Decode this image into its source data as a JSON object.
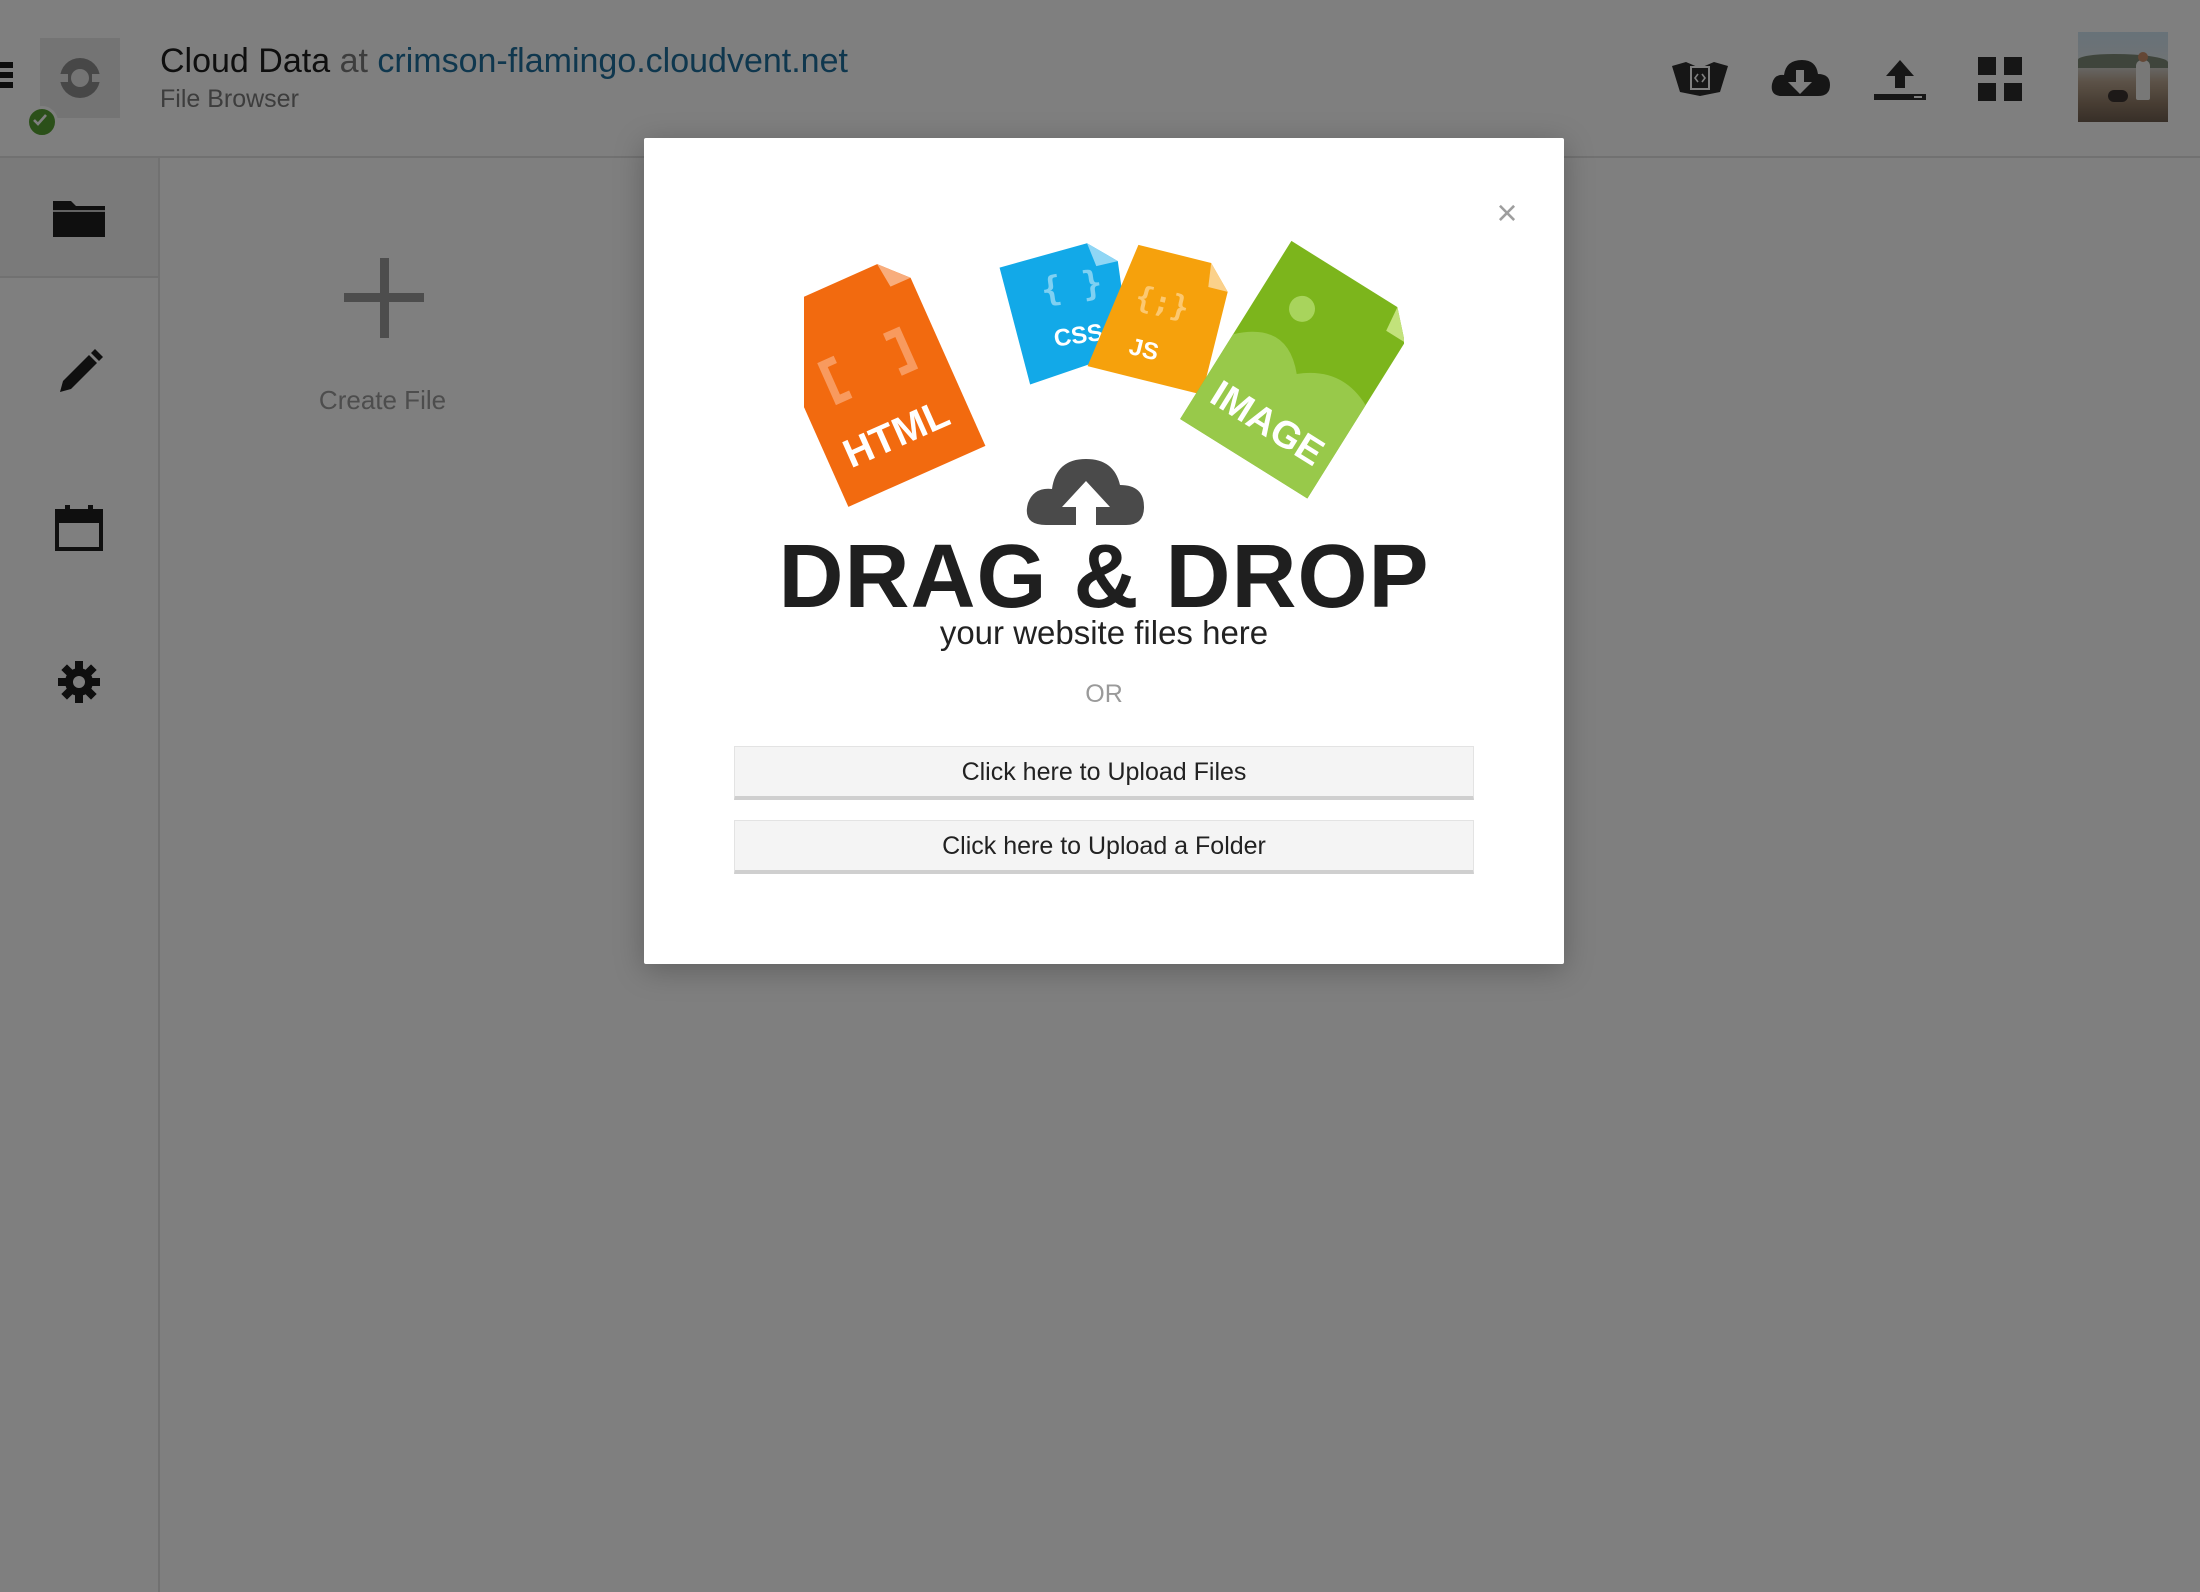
{
  "header": {
    "app_name": "Cloud Data",
    "at_word": "at",
    "domain": "crimson-flamingo.cloudvent.net",
    "subtitle": "File Browser",
    "icons": [
      "menu-icon",
      "app-logo-icon",
      "status-check-icon",
      "code-preview-icon",
      "cloud-download-icon",
      "upload-icon",
      "grid-icon",
      "avatar"
    ]
  },
  "sidebar": {
    "items": [
      {
        "icon": "folder-icon",
        "active": true
      },
      {
        "icon": "pencil-icon",
        "active": false
      },
      {
        "icon": "calendar-icon",
        "active": false
      },
      {
        "icon": "gear-icon",
        "active": false
      }
    ]
  },
  "main": {
    "create_file_label": "Create File"
  },
  "modal": {
    "close_symbol": "×",
    "illustration": {
      "html_label": "HTML",
      "css_label": "CSS",
      "js_label": "JS",
      "image_label": "IMAGE"
    },
    "headline": "DRAG & DROP",
    "subline": "your website files here",
    "or_text": "OR",
    "upload_files_label": "Click here to Upload Files",
    "upload_folder_label": "Click here to Upload a Folder"
  },
  "colors": {
    "html_file": "#f26a0f",
    "css_file": "#12a9e8",
    "js_file": "#f6a10c",
    "image_file": "#7cb51c",
    "cloud": "#4a4a4a",
    "link": "#1e6e9c"
  }
}
